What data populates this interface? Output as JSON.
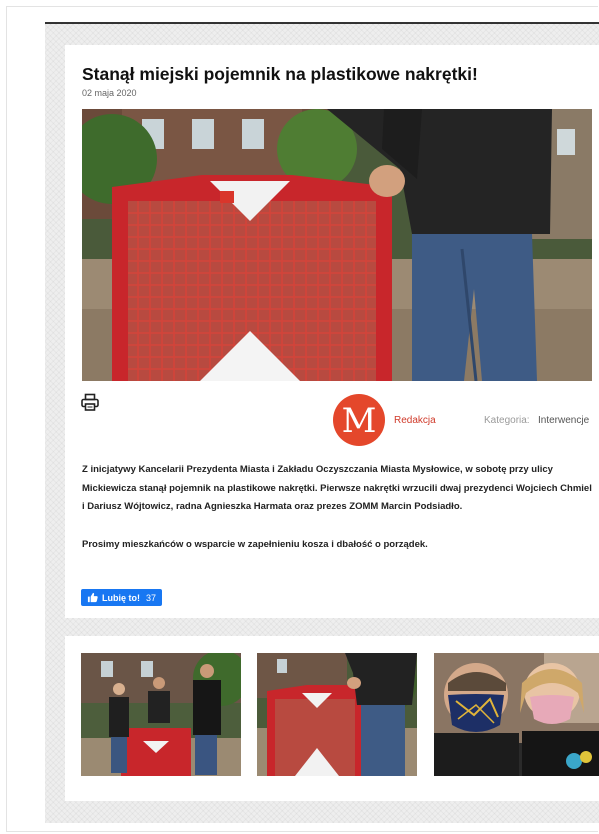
{
  "article": {
    "title": "Stanął miejski pojemnik na plastikowe nakrętki!",
    "date": "02 maja 2020",
    "main_image": {
      "subject": "red-mesh-cap-container-with-person"
    }
  },
  "meta": {
    "author": "Redakcja",
    "author_logo_letter": "M",
    "category_label": "Kategoria:",
    "category_value": "Interwencje"
  },
  "body": {
    "paragraph1": "Z inicjatywy Kancelarii Prezydenta Miasta i Zakładu Oczyszczania Miasta Mysłowice, w sobotę przy ulicy Mickiewicza stanął pojemnik na plastikowe nakrętki. Pierwsze nakrętki wrzucili dwaj prezydenci Wojciech Chmiel i Dariusz Wójtowicz, radna Agnieszka Harmata oraz prezes ZOMM Marcin Podsiadło.",
    "paragraph2": "Prosimy mieszkańców o wsparcie w zapełnieniu kosza i dbałość o porządek."
  },
  "like": {
    "label": "Lubię to!",
    "count": "37"
  },
  "gallery": [
    {
      "subject": "three-people-by-container"
    },
    {
      "subject": "container-with-person"
    },
    {
      "subject": "two-people-in-masks"
    }
  ],
  "colors": {
    "accent_red": "#d03a2a",
    "container_red": "#c8262b",
    "facebook_blue": "#1877f2"
  },
  "icons": [
    "print-icon",
    "thumbs-up-icon"
  ]
}
